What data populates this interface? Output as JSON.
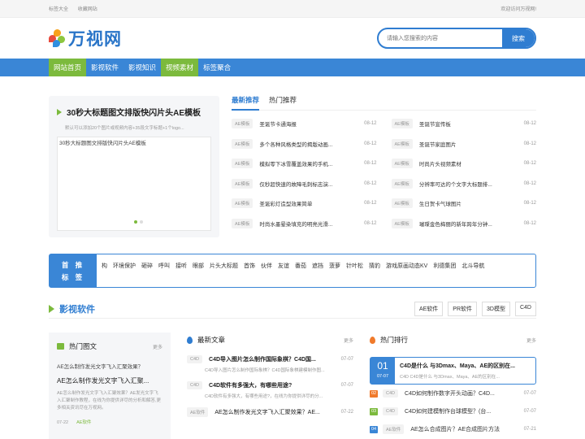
{
  "topbar": {
    "links": [
      "标签大全",
      "收藏网站"
    ],
    "welcome": "欢迎访问万视网!"
  },
  "header": {
    "logo_text": "万视网",
    "search_placeholder": "请输入您搜索的内容",
    "search_button": "搜索"
  },
  "nav": {
    "items": [
      "网站首页",
      "影视软件",
      "影视知识",
      "视频素材",
      "标签聚合"
    ],
    "active": [
      "网站首页",
      "视频素材"
    ]
  },
  "featured": {
    "title": "30秒大标题图文排版快闪片头AE模板",
    "desc": "默认可以添加20个图片或视频内容+35段文字标题+1个logo...",
    "image_alt": "30秒大标题图文排版快闪片头AE模板"
  },
  "recommend": {
    "tabs": [
      "最新推荐",
      "热门推荐"
    ],
    "left": [
      {
        "tag": "AE模板",
        "title": "圣诞节卡通海报",
        "date": "08-12"
      },
      {
        "tag": "AE模板",
        "title": "多个各种风格类型的揭版动画...",
        "date": "08-12"
      },
      {
        "tag": "AE模板",
        "title": "模拟零下冰雪覆盖效果的手机...",
        "date": "08-12"
      },
      {
        "tag": "AE模板",
        "title": "仅秒超快速的故障毛刺标志演...",
        "date": "08-12"
      },
      {
        "tag": "AE模板",
        "title": "圣诞彩灯造型效果简单",
        "date": "08-12"
      },
      {
        "tag": "AE模板",
        "title": "时尚水墨晕染填充的明亮光滑...",
        "date": "08-12"
      }
    ],
    "right": [
      {
        "tag": "AE模板",
        "title": "圣诞节宣传板",
        "date": "08-12"
      },
      {
        "tag": "AE模板",
        "title": "圣诞节家庭图片",
        "date": "08-12"
      },
      {
        "tag": "AE模板",
        "title": "时尚片头视频素材",
        "date": "08-12"
      },
      {
        "tag": "AE模板",
        "title": "分辨率可达的个文字大标题排...",
        "date": "08-12"
      },
      {
        "tag": "AE模板",
        "title": "生日贺卡气球图片",
        "date": "08-12"
      },
      {
        "tag": "AE模板",
        "title": "璀璨金色梅丽的新年跨年分钟...",
        "date": "08-12"
      }
    ]
  },
  "tags": {
    "label_line1": "首 推",
    "label_line2": "标 签",
    "items": [
      "构",
      "环境保护",
      "砸碎",
      "呼叫",
      "接听",
      "眼部",
      "片头大标题",
      "首饰",
      "伙伴",
      "友谊",
      "番茄",
      "遮挡",
      "菠萝",
      "针叶松",
      "猜豹",
      "游戏原画动态KV",
      "利德集团",
      "北斗导航"
    ]
  },
  "section": {
    "title": "影视软件",
    "buttons": [
      "AE软件",
      "PR软件",
      "3D模型",
      "C4D"
    ]
  },
  "hotpics": {
    "title": "热门图文",
    "more": "更多",
    "image_alt": "AE怎么制作发光文字飞入汇聚效果？",
    "headline": "AE怎么制作发光文字飞入汇聚...",
    "desc": "AE怎么制作发光文字飞入汇聚效果？AE发光文字飞入汇聚制作教程，在线为你提供详尽的分析和解答,更多相关资讯尽在万视网。",
    "date": "07-22",
    "category": "AE软件"
  },
  "latest": {
    "title": "最新文章",
    "more": "更多",
    "items": [
      {
        "tag": "C4D",
        "title": "C4D导入图片怎么制作国际象棋？C4D国...",
        "date": "07-07",
        "sub": "C4D导入图片怎么制作国际象棋？C4D国际象棋建模制作图..."
      },
      {
        "tag": "C4D",
        "title": "C4D软件有多强大，有哪些用途?",
        "date": "07-07",
        "sub": "C4D软件有多强大，有哪些用途?，在线为你提供详尽的分..."
      },
      {
        "tag": "AE软件",
        "title": "AE怎么制作发光文字飞入汇聚效果？AE...",
        "date": "07-22",
        "sub": ""
      }
    ]
  },
  "hot": {
    "title": "热门排行",
    "more": "更多",
    "top": {
      "day": "01",
      "month": "07-07",
      "title": "C4D是什么 与3Dmax、Maya、AE的区别在...",
      "sub": "C4D   C4D是什么 与3Dmax、Maya、AE的区别在..."
    },
    "items": [
      {
        "num": "02",
        "tag": "C4D",
        "title": "C4D如何制作数字开头动画？C4D...",
        "date": "07-07",
        "color": "#f07a2b"
      },
      {
        "num": "03",
        "tag": "C4D",
        "title": "C4D如何建模制作台球模型？(台...",
        "date": "07-07",
        "color": "#7cba3d"
      },
      {
        "num": "04",
        "tag": "AE软件",
        "title": "AE怎么合成图片？AE合成图片方法",
        "date": "07-21",
        "color": "#3a86d6"
      }
    ]
  }
}
